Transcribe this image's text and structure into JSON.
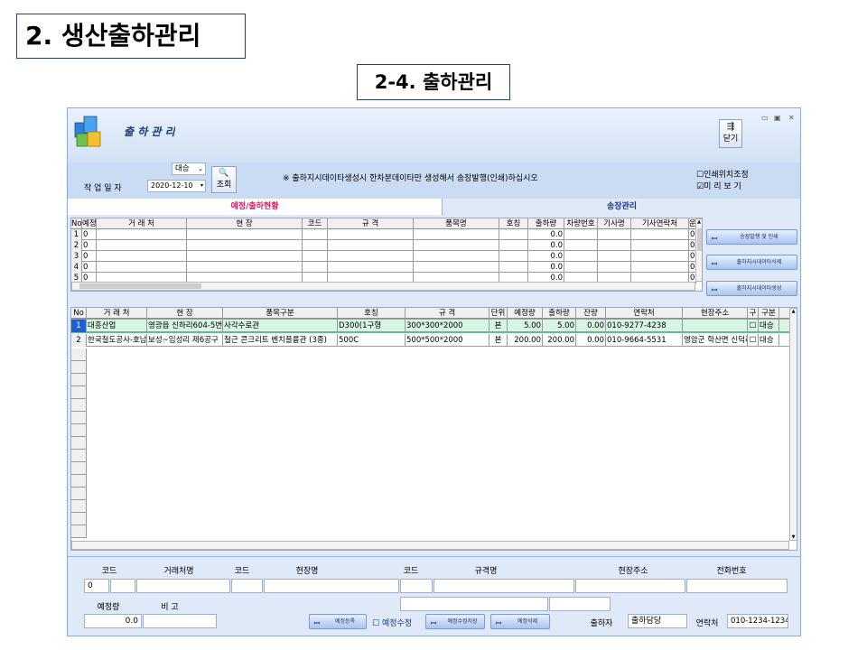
{
  "slide": {
    "title": "2. 생산출하관리",
    "subtitle": "2-4. 출하관리"
  },
  "window": {
    "title": "출 하 관 리",
    "close_label": "닫기",
    "controls": [
      "▭",
      "▣",
      "✕"
    ]
  },
  "filter": {
    "date_label": "작 업 일 자",
    "status_select": "대승",
    "date_value": "2020-12-10",
    "search_label": "조회",
    "notice": "※ 출하지시데이타생성시 한차분데이타만 생성해서 송장발행(인쇄)하십시오",
    "print_position_label": "인쇄위치조정",
    "preview_label": "미 리 보 기",
    "preview_checked": "☑",
    "print_position_checked": "☐"
  },
  "tabs": {
    "tab1": "예정/출하현황",
    "tab2": "송장관리"
  },
  "grid1": {
    "headers": [
      "No",
      "예정",
      "거 래 처",
      "현    장",
      "코드",
      "규 격",
      "품목명",
      "호칭",
      "출하량",
      "차량번호",
      "기사명",
      "기사연락처",
      "운"
    ],
    "rows": [
      {
        "no": "1",
        "plan": "0",
        "qty": "0.0",
        "last": "0"
      },
      {
        "no": "2",
        "plan": "0",
        "qty": "0.0",
        "last": "0"
      },
      {
        "no": "3",
        "plan": "0",
        "qty": "0.0",
        "last": "0"
      },
      {
        "no": "4",
        "plan": "0",
        "qty": "0.0",
        "last": "0"
      },
      {
        "no": "5",
        "plan": "0",
        "qty": "0.0",
        "last": "0"
      }
    ]
  },
  "actions": {
    "invoice_print": "송장발행 및 인쇄",
    "delete_data": "출하지시데이타삭제",
    "create_data": "출하지시데이타생성"
  },
  "grid2": {
    "headers": [
      "No",
      "거 래 처",
      "현    장",
      "품목구분",
      "호칭",
      "규 격",
      "단위",
      "예정량",
      "출하량",
      "잔량",
      "연락처",
      "현장주소",
      "구",
      "구분"
    ],
    "rows": [
      {
        "no": "1",
        "client": "대흥산업",
        "site": "영광읍 신하리604-5번지",
        "item": "사각수로관",
        "nominal": "D300(1구형",
        "spec": "300*300*2000",
        "unit": "본",
        "plan": "5.00",
        "ship": "5.00",
        "remain": "0.00",
        "phone": "010-9277-4238",
        "address": "",
        "check": "☐",
        "type": "대승"
      },
      {
        "no": "2",
        "client": "한국철도공사-호남",
        "site": "보성~임성리 제6공구",
        "item": "철근 콘크리트 벤치플륨관 (3종)",
        "nominal": "500C",
        "spec": "500*500*2000",
        "unit": "본",
        "plan": "200.00",
        "ship": "200.00",
        "remain": "0.00",
        "phone": "010-9664-5531",
        "address": "영암군 학산면 신덕리",
        "check": "☐",
        "type": "대승"
      }
    ]
  },
  "bottom": {
    "labels": {
      "code1": "코드",
      "client_name": "거래처명",
      "code2": "코드",
      "site_name": "현장명",
      "code3": "코드",
      "spec_name": "규격명",
      "site_address": "현장주소",
      "phone": "전화번호",
      "plan_qty": "예정량",
      "remark": "비 고",
      "shipper": "출하자",
      "contact": "연락처"
    },
    "code1_value": "0",
    "plan_qty_value": "0.0",
    "shipper_value": "출하담당",
    "contact_value": "010-1234-1234",
    "btn_register": "예정등록",
    "plan_edit_label": "예정수정",
    "btn_save": "예정수정저장",
    "btn_delete": "예정삭제"
  },
  "colors": {
    "selected_row": "#d6f5e3",
    "tab_active_text": "#d81b60",
    "tab_text": "#1a3a8a",
    "window_border": "#8faad0"
  }
}
